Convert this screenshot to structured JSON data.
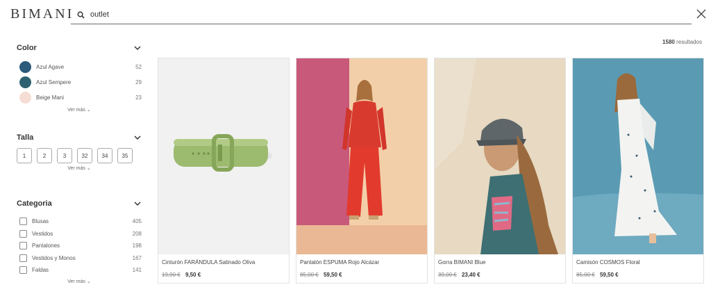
{
  "header": {
    "logo": "BIMANI",
    "search_value": "outlet",
    "search_icon": "search-icon",
    "close_icon": "close-icon"
  },
  "results": {
    "count": "1580",
    "label": "resultados"
  },
  "filters": {
    "color": {
      "title": "Color",
      "items": [
        {
          "label": "Azul Agave",
          "count": "52",
          "color": "#2b5a7a"
        },
        {
          "label": "Azul Sempere",
          "count": "29",
          "color": "#2e6170"
        },
        {
          "label": "Beige Mani",
          "count": "23",
          "color": "#f5ddd4"
        }
      ],
      "more": "Ver más"
    },
    "talla": {
      "title": "Talla",
      "sizes": [
        "1",
        "2",
        "3",
        "32",
        "34",
        "35"
      ],
      "more": "Ver más"
    },
    "categoria": {
      "title": "Categoria",
      "items": [
        {
          "label": "Blusas",
          "count": "405"
        },
        {
          "label": "Vestidos",
          "count": "208"
        },
        {
          "label": "Pantalones",
          "count": "198"
        },
        {
          "label": "Vestidos y Monos",
          "count": "167"
        },
        {
          "label": "Faldas",
          "count": "141"
        }
      ],
      "more": "Ver más"
    }
  },
  "products": [
    {
      "name": "Cinturón FARÁNDULA Satinado Oliva",
      "old_price": "19,90 €",
      "price": "9,50 €"
    },
    {
      "name": "Pantalón ESPUMA Rojo Alcázar",
      "old_price": "85,00 €",
      "price": "59,50 €"
    },
    {
      "name": "Gorra BIMANI Blue",
      "old_price": "39,00 €",
      "price": "23,40 €"
    },
    {
      "name": "Camisón COSMOS Floral",
      "old_price": "85,00 €",
      "price": "59,50 €"
    }
  ],
  "colors": {
    "text": "#3a3a3a",
    "border": "#e2e2e2",
    "accent": "#333333"
  }
}
